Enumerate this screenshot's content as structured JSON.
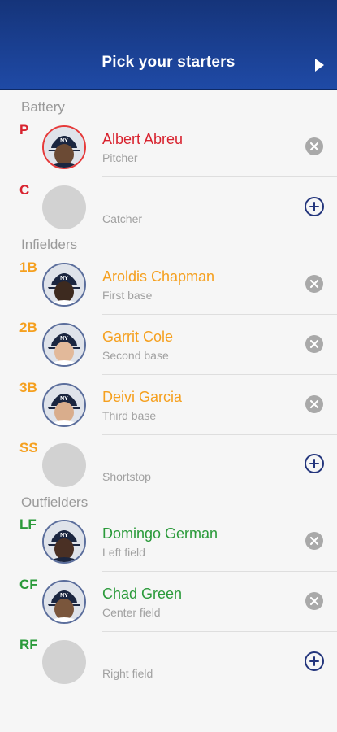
{
  "header": {
    "title": "Pick your starters"
  },
  "colors": {
    "battery": "#d8232f",
    "infield": "#f5a01f",
    "outfield": "#2a9a3a",
    "header": "#1f4aa6"
  },
  "sections": {
    "battery": "Battery",
    "infielders": "Infielders",
    "outfielders": "Outfielders"
  },
  "rows": [
    {
      "pos": "P",
      "name": "Albert Abreu",
      "role": "Pitcher",
      "filled": true
    },
    {
      "pos": "C",
      "name": "",
      "role": "Catcher",
      "filled": false
    },
    {
      "pos": "1B",
      "name": "Aroldis Chapman",
      "role": "First base",
      "filled": true
    },
    {
      "pos": "2B",
      "name": "Garrit Cole",
      "role": "Second base",
      "filled": true
    },
    {
      "pos": "3B",
      "name": "Deivi Garcia",
      "role": "Third base",
      "filled": true
    },
    {
      "pos": "SS",
      "name": "",
      "role": "Shortstop",
      "filled": false
    },
    {
      "pos": "LF",
      "name": "Domingo German",
      "role": "Left field",
      "filled": true
    },
    {
      "pos": "CF",
      "name": "Chad Green",
      "role": "Center field",
      "filled": true
    },
    {
      "pos": "RF",
      "name": "",
      "role": "Right field",
      "filled": false
    }
  ]
}
